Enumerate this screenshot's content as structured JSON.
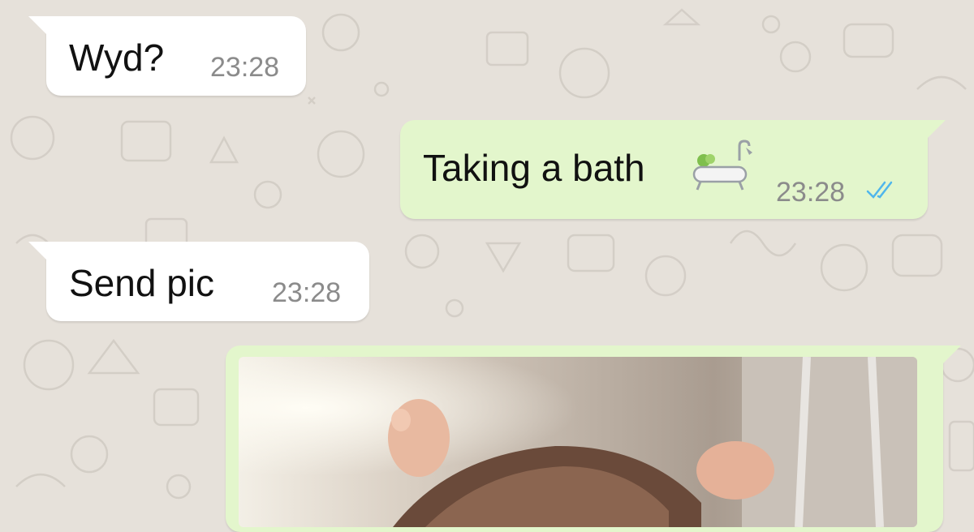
{
  "colors": {
    "background": "#e6e1da",
    "incoming_bubble": "#ffffff",
    "outgoing_bubble": "#e3f6cc",
    "timestamp": "#8b8b8b",
    "read_ticks": "#4fb6ec"
  },
  "messages": [
    {
      "direction": "incoming",
      "text": "Wyd?",
      "time": "23:28"
    },
    {
      "direction": "outgoing",
      "text": "Taking a bath",
      "emoji": "bathtub-icon",
      "time": "23:28",
      "status": "read"
    },
    {
      "direction": "incoming",
      "text": "Send pic",
      "time": "23:28"
    },
    {
      "direction": "outgoing",
      "type": "image"
    }
  ]
}
